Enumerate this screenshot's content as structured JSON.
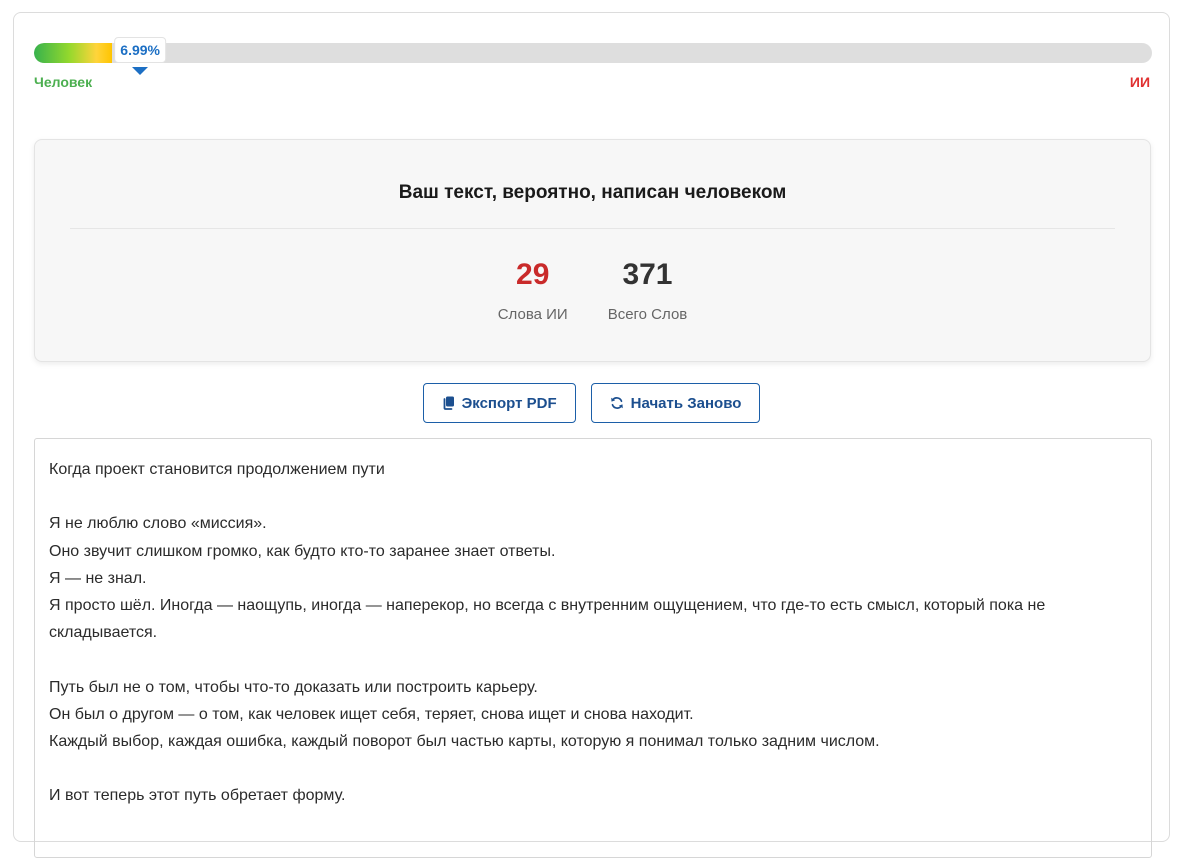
{
  "meter": {
    "percent_label": "6.99%",
    "ai_fraction": 0.0699,
    "human_label": "Человек",
    "ai_label": "ИИ"
  },
  "result": {
    "title": "Ваш текст, вероятно, написан человеком",
    "ai_words_value": "29",
    "ai_words_label": "Слова ИИ",
    "total_words_value": "371",
    "total_words_label": "Всего Слов",
    "ai_value_color": "#c92a2a"
  },
  "actions": {
    "export_label": "Экспорт PDF",
    "restart_label": "Начать Заново"
  },
  "text": {
    "lines": [
      "Когда проект становится продолжением пути",
      "",
      "Я не люблю слово «миссия».",
      "Оно звучит слишком громко, как будто кто-то заранее знает ответы.",
      "Я — не знал.",
      "Я просто шёл. Иногда — наощупь, иногда — наперекор, но всегда с внутренним ощущением, что где-то есть смысл, который пока не складывается.",
      "",
      "Путь был не о том, чтобы что-то доказать или построить карьеру.",
      "Он был о другом — о том, как человек ищет себя, теряет, снова ищет и снова находит.",
      "Каждый выбор, каждая ошибка, каждый поворот был частью карты, которую я понимал только задним числом.",
      "",
      "И вот теперь этот путь обретает форму."
    ]
  },
  "icons": {
    "export": "copy-icon",
    "restart": "refresh-icon"
  },
  "colors": {
    "accent": "#1c6fc4",
    "human": "#4caf50",
    "ai": "#e03131"
  }
}
